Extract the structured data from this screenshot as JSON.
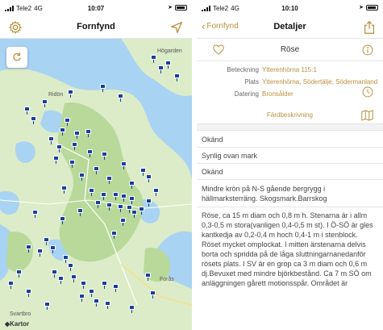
{
  "left_screen": {
    "status": {
      "carrier": "Tele2",
      "network": "4G",
      "time": "10:07"
    },
    "nav": {
      "title": "Fornfynd",
      "left_icon": "gear-icon",
      "right_icon": "location-arrow-icon"
    },
    "map": {
      "places": {
        "hogarden": "Högarden",
        "riddon": "Ridön",
        "foras": "Forås",
        "svartbro": "Svartbro"
      },
      "attribution": "Kartor",
      "refresh_icon": "refresh-icon"
    }
  },
  "right_screen": {
    "status": {
      "carrier": "Tele2",
      "network": "4G",
      "time": "10:10"
    },
    "nav": {
      "back_label": "Fornfynd",
      "title": "Detaljer",
      "right_icon": "share-icon"
    },
    "detail": {
      "name": "Röse",
      "fields": [
        {
          "key": "Beteckning",
          "value": "Ytterenhörna 115:1"
        },
        {
          "key": "Plats",
          "value": "Ytterenhörna, Södertälje, Södermanland"
        },
        {
          "key": "Datering",
          "value": "Bronsålder"
        }
      ],
      "fard_label": "Färdbeskrivning",
      "items": [
        "Okänd",
        "Synlig ovan mark",
        "Okänd"
      ],
      "terrain": "Mindre krön på N-S gående bergrygg i hällmarksterräng. Skogsmark.Barrskog",
      "description": "Röse, ca 15 m diam och 0,8 m h. Stenarna är i allm 0,3-0,5 m stora(vanligen 0,4-0,5 m st). I Ö-SÖ är gles kantkedja av 0,2-0,4 m hoch 0,4-1 m i stenblock. Röset mycket omplockat. I mitten ärstenarna delvis borta och spridda på de låga sluttningarnanedanför rösets plats. I SV är en grop ca 3 m diam och 0,6 m dj.Bevuxet med mindre björkbestånd. Ca 7 m SÖ om anläggningen gårett motionsspår. Området är"
    }
  },
  "colors": {
    "accent": "#b9913f",
    "marker": "#1d3f9c",
    "water": "#a9d3f2",
    "land": "#dcecc8"
  }
}
